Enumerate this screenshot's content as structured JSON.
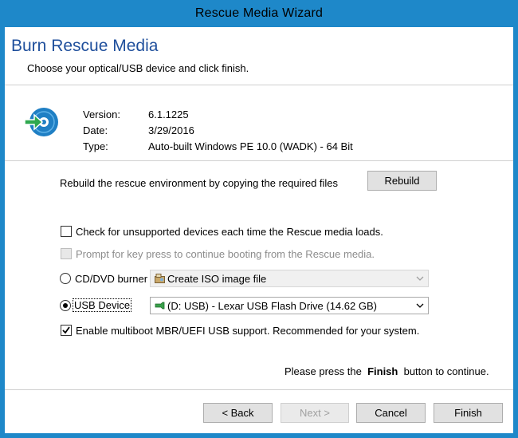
{
  "window": {
    "title": "Rescue Media Wizard"
  },
  "header": {
    "title": "Burn Rescue Media",
    "subtitle": "Choose your optical/USB device and click finish."
  },
  "info": {
    "version_label": "Version:",
    "version_value": "6.1.1225",
    "date_label": "Date:",
    "date_value": "3/29/2016",
    "type_label": "Type:",
    "type_value": "Auto-built Windows PE 10.0 (WADK) - 64 Bit"
  },
  "rebuild": {
    "text": "Rebuild the rescue environment by copying the required files",
    "button": "Rebuild"
  },
  "options": {
    "check_unsupported": {
      "label": "Check for unsupported devices each time the Rescue media loads.",
      "checked": false
    },
    "prompt_key": {
      "label": "Prompt for key press to continue booting from the Rescue media.",
      "checked": false,
      "disabled": true
    },
    "multiboot": {
      "label": "Enable multiboot MBR/UEFI USB support. Recommended for your system.",
      "checked": true
    }
  },
  "devices": {
    "cd_label": "CD/DVD burner",
    "cd_selected": "Create ISO image file",
    "usb_label": "USB Device",
    "usb_selected": "(D: USB) - Lexar   USB Flash Drive (14.62 GB)",
    "selected_device": "USB Device"
  },
  "note": {
    "before": "Please press the",
    "emphasis": "Finish",
    "after": "button to continue."
  },
  "buttons": {
    "back": "< Back",
    "next": "Next >",
    "cancel": "Cancel",
    "finish": "Finish"
  },
  "colors": {
    "titlebar": "#1e88c9",
    "header_title": "#1f4f9c",
    "icon_blue": "#1f7fc4",
    "icon_arrow": "#2fa84f"
  }
}
